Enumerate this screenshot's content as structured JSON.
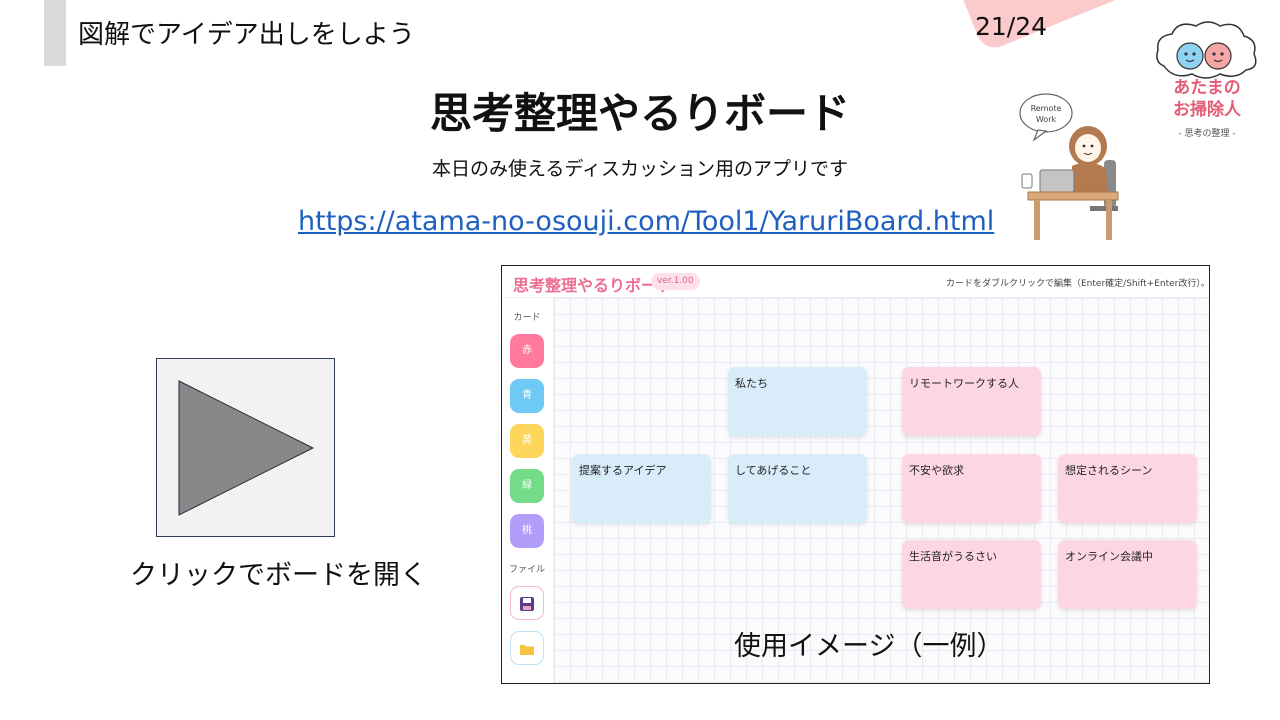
{
  "header": {
    "section_title": "図解でアイデア出しをしよう",
    "page_number": "21/24"
  },
  "brand": {
    "line1": "あたまの",
    "line2": "お掃除人",
    "sub": "- 思考の整理 -"
  },
  "mascot": {
    "bubble_line1": "Remote",
    "bubble_line2": "Work"
  },
  "main": {
    "title": "思考整理やるりボード",
    "subtitle": "本日のみ使えるディスカッション用のアプリです",
    "link": "https://atama-no-osouji.com/Tool1/YaruriBoard.html"
  },
  "play": {
    "caption": "クリックでボードを開く",
    "icon": "play-icon"
  },
  "app": {
    "title": "思考整理やるりボード",
    "version": "ver.1.00",
    "hint": "カードをダブルクリックで編集（Enter確定/Shift+Enter改行）。ドラッグで移動。ス",
    "sidebar": {
      "cards_label": "カード",
      "swatches": [
        {
          "label": "赤",
          "color": "#ff7a9c"
        },
        {
          "label": "青",
          "color": "#6ec9f5"
        },
        {
          "label": "黄",
          "color": "#ffd65c"
        },
        {
          "label": "緑",
          "color": "#72dc88"
        },
        {
          "label": "桃",
          "color": "#b39dfa"
        }
      ],
      "file_label": "ファイル",
      "save_icon": "save-icon",
      "open_icon": "folder-icon"
    },
    "cards": [
      {
        "text": "私たち",
        "color": "blue"
      },
      {
        "text": "リモートワークする人",
        "color": "pink"
      },
      {
        "text": "提案するアイデア",
        "color": "blue"
      },
      {
        "text": "してあげること",
        "color": "blue"
      },
      {
        "text": "不安や欲求",
        "color": "pink"
      },
      {
        "text": "想定されるシーン",
        "color": "pink"
      },
      {
        "text": "生活音がうるさい",
        "color": "pink"
      },
      {
        "text": "オンライン会議中",
        "color": "pink"
      }
    ]
  },
  "usage_caption": "使用イメージ（一例）"
}
